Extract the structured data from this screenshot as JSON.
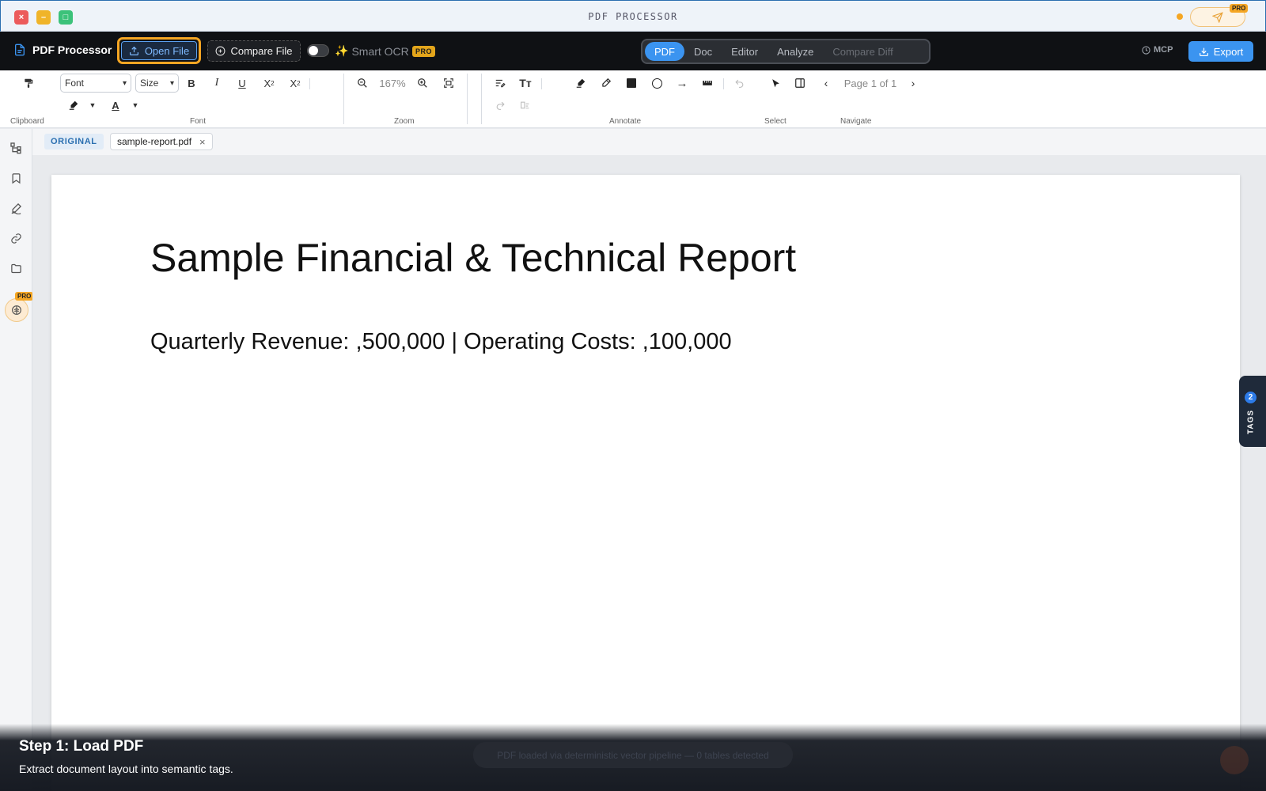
{
  "window": {
    "title": "PDF PROCESSOR",
    "send_pro_badge": "PRO"
  },
  "header": {
    "app_name": "PDF Processor",
    "open_file_label": "Open File",
    "compare_file_label": "Compare File",
    "smart_ocr_label": "Smart OCR",
    "smart_ocr_enabled": false,
    "pro_badge": "PRO",
    "mode_tabs": [
      {
        "label": "PDF",
        "active": true
      },
      {
        "label": "Doc",
        "active": false
      },
      {
        "label": "Editor",
        "active": false
      },
      {
        "label": "Analyze",
        "active": false
      },
      {
        "label": "Compare Diff",
        "active": false,
        "disabled": true
      }
    ],
    "mcp_label": "MCP",
    "export_label": "Export"
  },
  "ribbon": {
    "font_select": "Font",
    "size_select": "Size",
    "zoom_level": "167%",
    "page_indicator": "Page 1 of 1",
    "groups": {
      "clipboard": "Clipboard",
      "font": "Font",
      "zoom": "Zoom",
      "annotate": "Annotate",
      "select": "Select",
      "navigate": "Navigate"
    }
  },
  "sidebar": {
    "items": [
      "structure-icon",
      "bookmark-icon",
      "signature-icon",
      "link-icon",
      "folder-icon"
    ],
    "pro_badge": "PRO"
  },
  "tabs": {
    "original_badge": "ORIGINAL",
    "file_name": "sample-report.pdf",
    "close_glyph": "×"
  },
  "document": {
    "title": "Sample Financial & Technical Report",
    "line1": "Quarterly Revenue: ,500,000 | Operating Costs: ,100,000"
  },
  "tags_panel": {
    "count": "2",
    "label": "TAGS"
  },
  "overlay": {
    "toast": "PDF loaded via deterministic vector pipeline — 0 tables detected",
    "step_title": "Step 1: Load PDF",
    "step_desc": "Extract document layout into semantic tags."
  },
  "colors": {
    "accent": "#3b94f0",
    "highlight_ring": "#f5a623",
    "toolbar_bg": "#0f1114",
    "pro": "#e3a51b"
  }
}
